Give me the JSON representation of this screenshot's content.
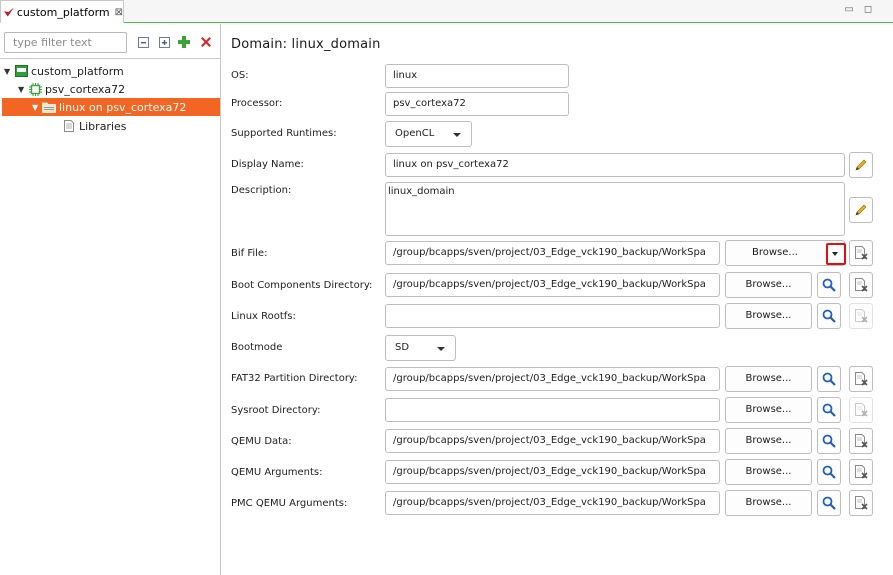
{
  "tab": {
    "title": "custom_platform",
    "close_glyph": "⊠"
  },
  "window_controls": {
    "minimize": "▭",
    "maximize": "◻"
  },
  "tree": {
    "filter_placeholder": "type filter text",
    "toolbar_icons": [
      "collapse-all-icon",
      "expand-all-icon",
      "add-icon",
      "remove-icon"
    ],
    "items": [
      {
        "label": "custom_platform",
        "icon": "platform-icon",
        "expanded": true,
        "selected": false
      },
      {
        "label": "psv_cortexa72",
        "icon": "processor-icon",
        "expanded": true,
        "selected": false
      },
      {
        "label": "linux on psv_cortexa72",
        "icon": "domain-folder-icon",
        "expanded": true,
        "selected": true
      },
      {
        "label": "Libraries",
        "icon": "libraries-icon",
        "expanded": false,
        "selected": false
      }
    ]
  },
  "domain": {
    "title": "Domain: linux_domain"
  },
  "form": {
    "os": {
      "label": "OS:",
      "value": "linux"
    },
    "processor": {
      "label": "Processor:",
      "value": "psv_cortexa72"
    },
    "runtimes": {
      "label": "Supported Runtimes:",
      "value": "OpenCL"
    },
    "display_name": {
      "label": "Display Name:",
      "value": "linux on psv_cortexa72"
    },
    "description": {
      "label": "Description:",
      "value": "linux_domain"
    },
    "bif_file": {
      "label": "Bif File:",
      "value": "/group/bcapps/sven/project/03_Edge_vck190_backup/WorkSpa",
      "button": "Browse..."
    },
    "boot_dir": {
      "label": "Boot Components Directory:",
      "value": "/group/bcapps/sven/project/03_Edge_vck190_backup/WorkSpa",
      "button": "Browse..."
    },
    "rootfs": {
      "label": "Linux Rootfs:",
      "value": "",
      "button": "Browse..."
    },
    "bootmode": {
      "label": "Bootmode",
      "value": "SD"
    },
    "fat32": {
      "label": "FAT32 Partition Directory:",
      "value": "/group/bcapps/sven/project/03_Edge_vck190_backup/WorkSpa",
      "button": "Browse..."
    },
    "sysroot": {
      "label": "Sysroot Directory:",
      "value": "",
      "button": "Browse..."
    },
    "qemu_data": {
      "label": "QEMU Data:",
      "value": "/group/bcapps/sven/project/03_Edge_vck190_backup/WorkSpa",
      "button": "Browse..."
    },
    "qemu_args": {
      "label": "QEMU Arguments:",
      "value": "/group/bcapps/sven/project/03_Edge_vck190_backup/WorkSpa",
      "button": "Browse..."
    },
    "pmc_qemu_args": {
      "label": "PMC QEMU Arguments:",
      "value": "/group/bcapps/sven/project/03_Edge_vck190_backup/WorkSpa",
      "button": "Browse..."
    }
  },
  "colors": {
    "selection": "#f26522",
    "accent_green": "#4bbd4b",
    "search_blue": "#1f5fbf",
    "annotation_red": "#e01010"
  }
}
